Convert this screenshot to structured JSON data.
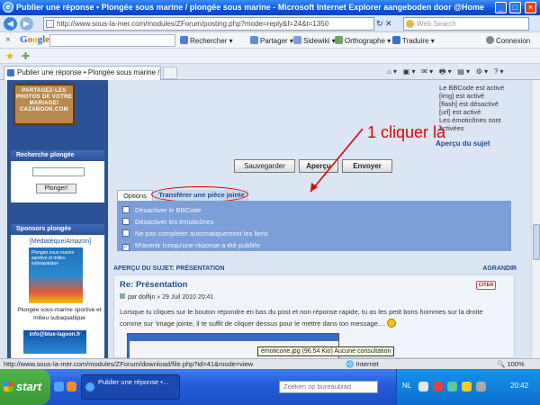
{
  "window": {
    "title": "Publier une réponse • Plongée sous marine / plongée sous marine - Microsoft Internet Explorer aangeboden door @Home"
  },
  "addressbar": {
    "url": "http://www.sous-la-mer.com/modules/ZForum/posting.php?mode=reply&f=24&t=1350",
    "search_placeholder": "Web Search"
  },
  "google_toolbar": {
    "logo": "Google",
    "buttons": [
      "Rechercher",
      "Partager",
      "Sidewiki",
      "Orthographe",
      "Traduire",
      "Connexion"
    ]
  },
  "tab": {
    "label": "Publier une réponse • Plongée sous marine / plongée ..."
  },
  "sidebar": {
    "banner_text": "PARTAGEZ-LES PHOTOS DE VOTRE MARIAGE! CAZABOOK.COM",
    "search_title": "Recherche plongée",
    "search_button": "Plonger!",
    "sponsors_title": "Sponsors plongée",
    "amazon_label": "[Médiatèque/Amazon]",
    "book_title": "Plongée sous-marine sportive et milieu subaquatique",
    "book_caption": "Plongée sous-marine sportive et milieu subaquatique",
    "ad2_text": "info@blue-lagoon.fr"
  },
  "bbcode": {
    "lines": [
      "Le BBCode est activé",
      "[img] est activé",
      "[flash] est désactivé",
      "[url] est activé",
      "Les émoticônes sont activées"
    ],
    "apercu_link": "Aperçu du sujet"
  },
  "buttons": {
    "save": "Sauvegarder",
    "preview": "Aperçu",
    "send": "Envoyer"
  },
  "annotation": "1 cliquer là",
  "tabs": {
    "options": "Options",
    "upload": "Transférer une pièce jointe"
  },
  "options": [
    {
      "label": "Désactiver le BBCode",
      "checked": false
    },
    {
      "label": "Désactiver les émoticônes",
      "checked": false
    },
    {
      "label": "Ne pas compléter automatiquement les liens",
      "checked": false
    },
    {
      "label": "M'avertir lorsqu'une réponse a été publiée",
      "checked": true
    }
  ],
  "preview": {
    "header": "APERÇU DU SUJET: PRÉSENTATION",
    "expand": "AGRANDIR",
    "post_title": "Re: Présentation",
    "post_meta": "par dolfijn » 29 Juil 2010 20:41",
    "citer": "CITER",
    "post_text": "Lorsque tu cliques sur le bouton répondre en bas du post et non réponse rapide, tu as les petit bons hommes sur la droite comme sur 'image jointe, il te suffit de cliquer dessus pour le mettre dans ton message....",
    "tooltip": "émoticone.jpg (96.54 Kio) Aucune consultation"
  },
  "statusbar": {
    "url": "http://www.sous-la-mer.com/modules/ZForum/download/file.php?id=41&mode=view",
    "zone": "Internet",
    "zoom": "100%"
  },
  "taskbar": {
    "start": "start",
    "item": "Publier une réponse •...",
    "search_placeholder": "Zoeken op bureaublad",
    "lang": "NL",
    "time": "20:42"
  }
}
